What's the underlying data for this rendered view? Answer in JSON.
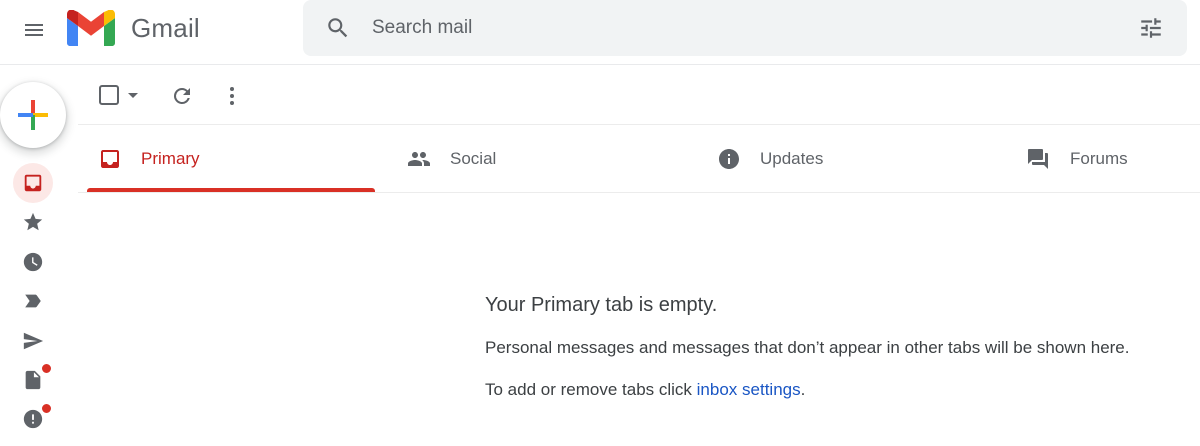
{
  "app": {
    "name": "Gmail"
  },
  "colors": {
    "accent_red": "#d93025",
    "link_blue": "#1a56c4",
    "search_bg": "#f1f3f4"
  },
  "header": {
    "menu_icon": "hamburger-menu-icon",
    "logo_icon": "gmail-m-logo",
    "search": {
      "placeholder": "Search mail",
      "icon": "search-icon",
      "options_icon": "tune-filter-icon"
    }
  },
  "compose": {
    "icon": "plus-icon"
  },
  "toolbar": {
    "select_icon": "checkbox-icon",
    "select_menu_icon": "caret-down-icon",
    "refresh_icon": "refresh-icon",
    "more_icon": "more-vert-icon"
  },
  "tabs": [
    {
      "label": "Primary",
      "icon": "inbox-icon",
      "active": true
    },
    {
      "label": "Social",
      "icon": "people-icon",
      "active": false
    },
    {
      "label": "Updates",
      "icon": "info-icon",
      "active": false
    },
    {
      "label": "Forums",
      "icon": "forum-icon",
      "active": false
    }
  ],
  "sidebar": {
    "items": [
      {
        "icon": "inbox-icon",
        "active": true,
        "badge": false
      },
      {
        "icon": "star-icon",
        "active": false,
        "badge": false
      },
      {
        "icon": "clock-icon",
        "active": false,
        "badge": false
      },
      {
        "icon": "label-icon",
        "active": false,
        "badge": false
      },
      {
        "icon": "send-icon",
        "active": false,
        "badge": false
      },
      {
        "icon": "draft-icon",
        "active": false,
        "badge": true
      },
      {
        "icon": "spam-icon",
        "active": false,
        "badge": true
      }
    ]
  },
  "empty_state": {
    "title": "Your Primary tab is empty.",
    "description": "Personal messages and messages that don’t appear in other tabs will be shown here.",
    "hint_prefix": "To add or remove tabs click ",
    "hint_link": "inbox settings",
    "hint_suffix": "."
  }
}
